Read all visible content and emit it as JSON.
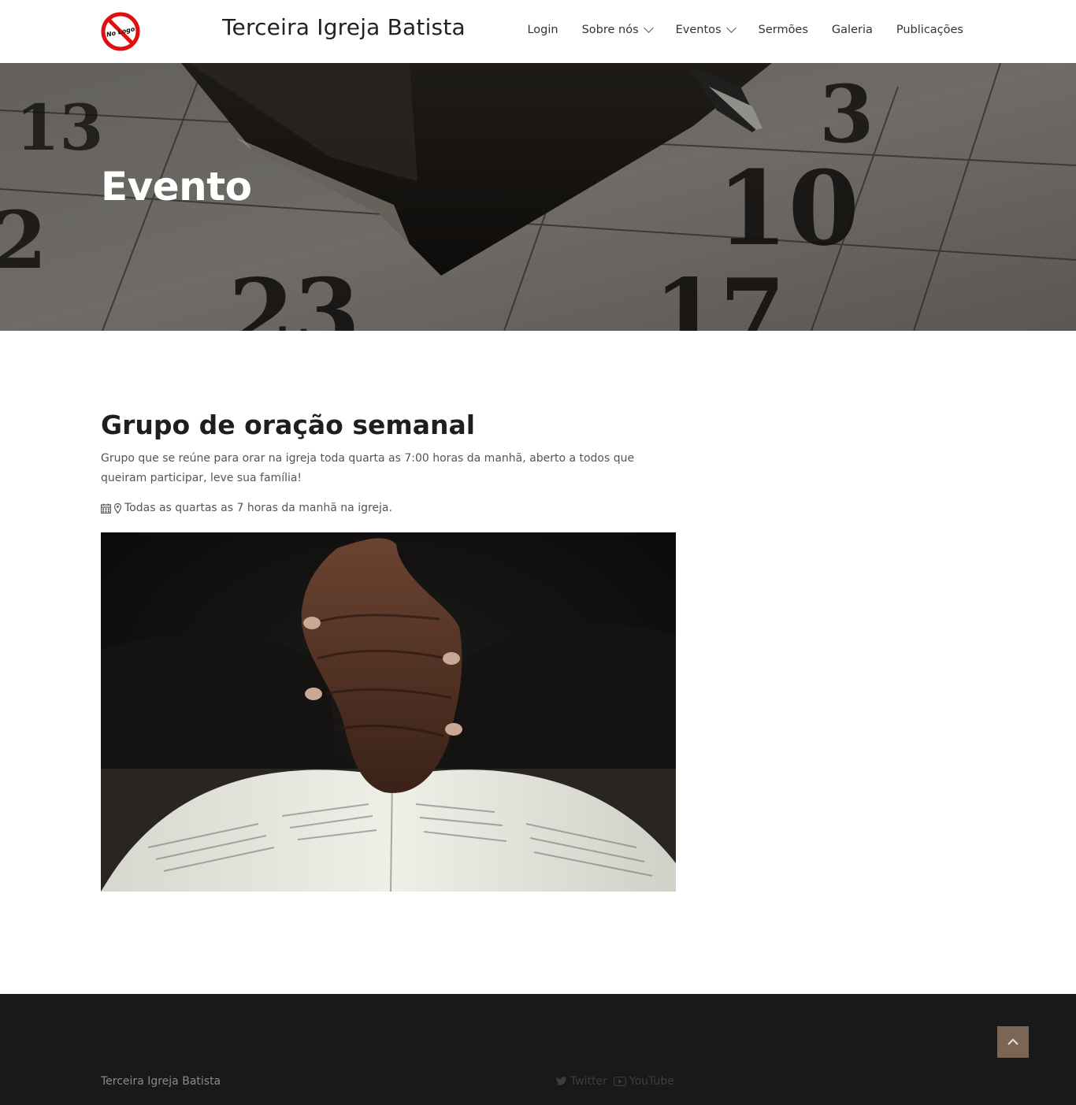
{
  "header": {
    "logo_text": "No Logo",
    "site_title": "Terceira Igreja Batista",
    "nav": [
      {
        "label": "Login",
        "has_dropdown": false
      },
      {
        "label": "Sobre nós",
        "has_dropdown": true
      },
      {
        "label": "Eventos",
        "has_dropdown": true
      },
      {
        "label": "Sermões",
        "has_dropdown": false
      },
      {
        "label": "Galeria",
        "has_dropdown": false
      },
      {
        "label": "Publicações",
        "has_dropdown": false
      }
    ]
  },
  "hero": {
    "title": "Evento",
    "background": "calendar-with-notebook-and-pen-photo"
  },
  "event": {
    "title": "Grupo de oração semanal",
    "description": "Grupo que se reúne para orar na igreja toda quarta as 7:00 horas da manhã, aberto a todos que queiram participar, leve sua família!",
    "meta_text": "Todas as quartas as 7 horas da manhã na igreja.",
    "meta_icons": [
      "calendar-icon",
      "map-marker-icon"
    ],
    "image": "praying-hands-on-open-bible-photo"
  },
  "footer": {
    "site_name": "Terceira Igreja Batista",
    "social": [
      {
        "label": "Twitter",
        "icon": "twitter-icon"
      },
      {
        "label": "YouTube",
        "icon": "youtube-icon"
      }
    ],
    "back_to_top_icon": "chevron-up-icon"
  },
  "colors": {
    "header_bg": "#ffffff",
    "footer_bg": "#1a1919",
    "back_to_top_bg": "#7b6656",
    "hero_title": "#ffffff"
  }
}
